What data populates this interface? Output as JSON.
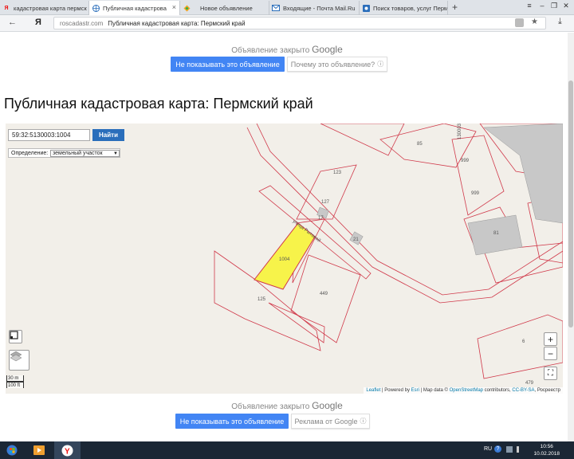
{
  "tabs": [
    {
      "title": "кадастровая карта пермск",
      "icon": "yandex-icon"
    },
    {
      "title": "Публичная кадастрова",
      "icon": "globe-icon",
      "close": "×"
    },
    {
      "title": "Новое объявление",
      "icon": "diamond-icon"
    },
    {
      "title": "Входящие - Почта Mail.Ru",
      "icon": "mail-icon"
    },
    {
      "title": "Поиск товаров, услуг Перм",
      "icon": "avito-icon"
    }
  ],
  "new_tab": "+",
  "window_controls": [
    "≡",
    "–",
    "❐",
    "✕"
  ],
  "address": {
    "back": "←",
    "logo": "Я",
    "domain": "roscadastr.com",
    "title": "Публичная кадастровая карта: Пермский край",
    "star": "★",
    "download": "⤓"
  },
  "ad_top": {
    "closed_text": "Объявление закрыто",
    "brand": "Google",
    "hide_button": "Не показывать это объявление",
    "why_button": "Почему это объявление?"
  },
  "heading": "Публичная кадастровая карта: Пермский край",
  "map": {
    "search_value": "59:32:5130003:1004",
    "find_button": "Найти",
    "definition_label": "Определение:",
    "definition_value": "земельный участок",
    "zoom_in": "+",
    "zoom_out": "−",
    "fullscreen": "⛶",
    "scale_m": "30 m",
    "scale_ft": "100 ft",
    "attribution": {
      "leaflet": "Leaflet",
      "sep1": " | Powered by ",
      "esri": "Esri",
      "sep2": " | Map data © ",
      "osm": "OpenStreetMap",
      "sep3": " contributors, ",
      "cc": "CC-BY-SA",
      "sep4": ", Росреестр"
    },
    "labels": [
      "123",
      "127",
      "17",
      "1004",
      "125",
      "449",
      "21",
      "85",
      "999",
      "999",
      "81",
      "6",
      "479",
      "130003",
      "улица Рытовой"
    ],
    "highlight_color": "#f7f34a",
    "boundary_color": "#d0394a"
  },
  "ad_bottom": {
    "closed_text": "Объявление закрыто",
    "brand": "Google",
    "hide_button": "Не показывать это объявление",
    "why_button": "Реклама от Google"
  },
  "taskbar": {
    "lang": "RU",
    "time": "10:56",
    "date": "10.02.2018"
  }
}
